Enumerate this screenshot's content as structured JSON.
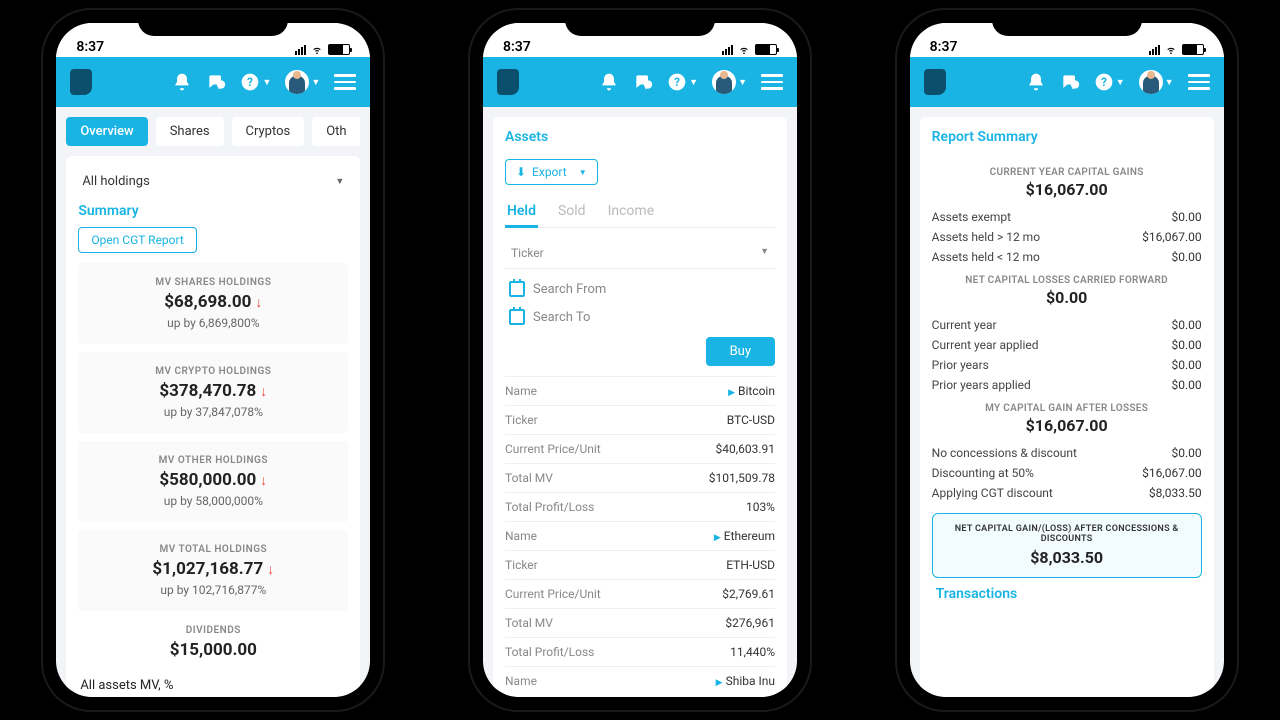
{
  "status": {
    "time": "8:37"
  },
  "phone1": {
    "tabs": [
      "Overview",
      "Shares",
      "Cryptos",
      "Oth"
    ],
    "holdings_dropdown": "All holdings",
    "summary_label": "Summary",
    "cgt_button": "Open CGT Report",
    "metrics": [
      {
        "label": "MV SHARES HOLDINGS",
        "value": "$68,698.00",
        "sub": "up by 6,869,800%"
      },
      {
        "label": "MV CRYPTO HOLDINGS",
        "value": "$378,470.78",
        "sub": "up by 37,847,078%"
      },
      {
        "label": "MV OTHER HOLDINGS",
        "value": "$580,000.00",
        "sub": "up by 58,000,000%"
      },
      {
        "label": "MV TOTAL HOLDINGS",
        "value": "$1,027,168.77",
        "sub": "up by 102,716,877%"
      },
      {
        "label": "DIVIDENDS",
        "value": "$15,000.00",
        "sub": ""
      }
    ],
    "cutoff": "All assets MV, %"
  },
  "phone2": {
    "title": "Assets",
    "export": "Export",
    "subtabs": [
      "Held",
      "Sold",
      "Income"
    ],
    "ticker_label": "Ticker",
    "search_from": "Search From",
    "search_to": "Search To",
    "buy": "Buy",
    "rows": [
      {
        "label": "Name",
        "value": "Bitcoin",
        "tri": true
      },
      {
        "label": "Ticker",
        "value": "BTC-USD"
      },
      {
        "label": "Current Price/Unit",
        "value": "$40,603.91"
      },
      {
        "label": "Total MV",
        "value": "$101,509.78"
      },
      {
        "label": "Total Profit/Loss",
        "value": "103%"
      },
      {
        "label": "Name",
        "value": "Ethereum",
        "tri": true
      },
      {
        "label": "Ticker",
        "value": "ETH-USD"
      },
      {
        "label": "Current Price/Unit",
        "value": "$2,769.61"
      },
      {
        "label": "Total MV",
        "value": "$276,961"
      },
      {
        "label": "Total Profit/Loss",
        "value": "11,440%"
      },
      {
        "label": "Name",
        "value": "Shiba Inu",
        "tri": true
      }
    ]
  },
  "phone3": {
    "title": "Report Summary",
    "s1_title": "CURRENT YEAR CAPITAL GAINS",
    "s1_value": "$16,067.00",
    "s1_rows": [
      {
        "lbl": "Assets exempt",
        "val": "$0.00"
      },
      {
        "lbl": "Assets held > 12 mo",
        "val": "$16,067.00"
      },
      {
        "lbl": "Assets held < 12 mo",
        "val": "$0.00"
      }
    ],
    "s2_title": "NET CAPITAL LOSSES CARRIED FORWARD",
    "s2_value": "$0.00",
    "s2_rows": [
      {
        "lbl": "Current year",
        "val": "$0.00"
      },
      {
        "lbl": "Current year applied",
        "val": "$0.00"
      },
      {
        "lbl": "Prior years",
        "val": "$0.00"
      },
      {
        "lbl": "Prior years applied",
        "val": "$0.00"
      }
    ],
    "s3_title": "MY CAPITAL GAIN AFTER LOSSES",
    "s3_value": "$16,067.00",
    "s3_rows": [
      {
        "lbl": "No concessions & discount",
        "val": "$0.00"
      },
      {
        "lbl": "Discounting at 50%",
        "val": "$16,067.00"
      },
      {
        "lbl": "Applying CGT discount",
        "val": "$8,033.50"
      }
    ],
    "net_title": "NET CAPITAL GAIN/(LOSS) AFTER CONCESSIONS & DISCOUNTS",
    "net_value": "$8,033.50",
    "transactions": "Transactions"
  }
}
